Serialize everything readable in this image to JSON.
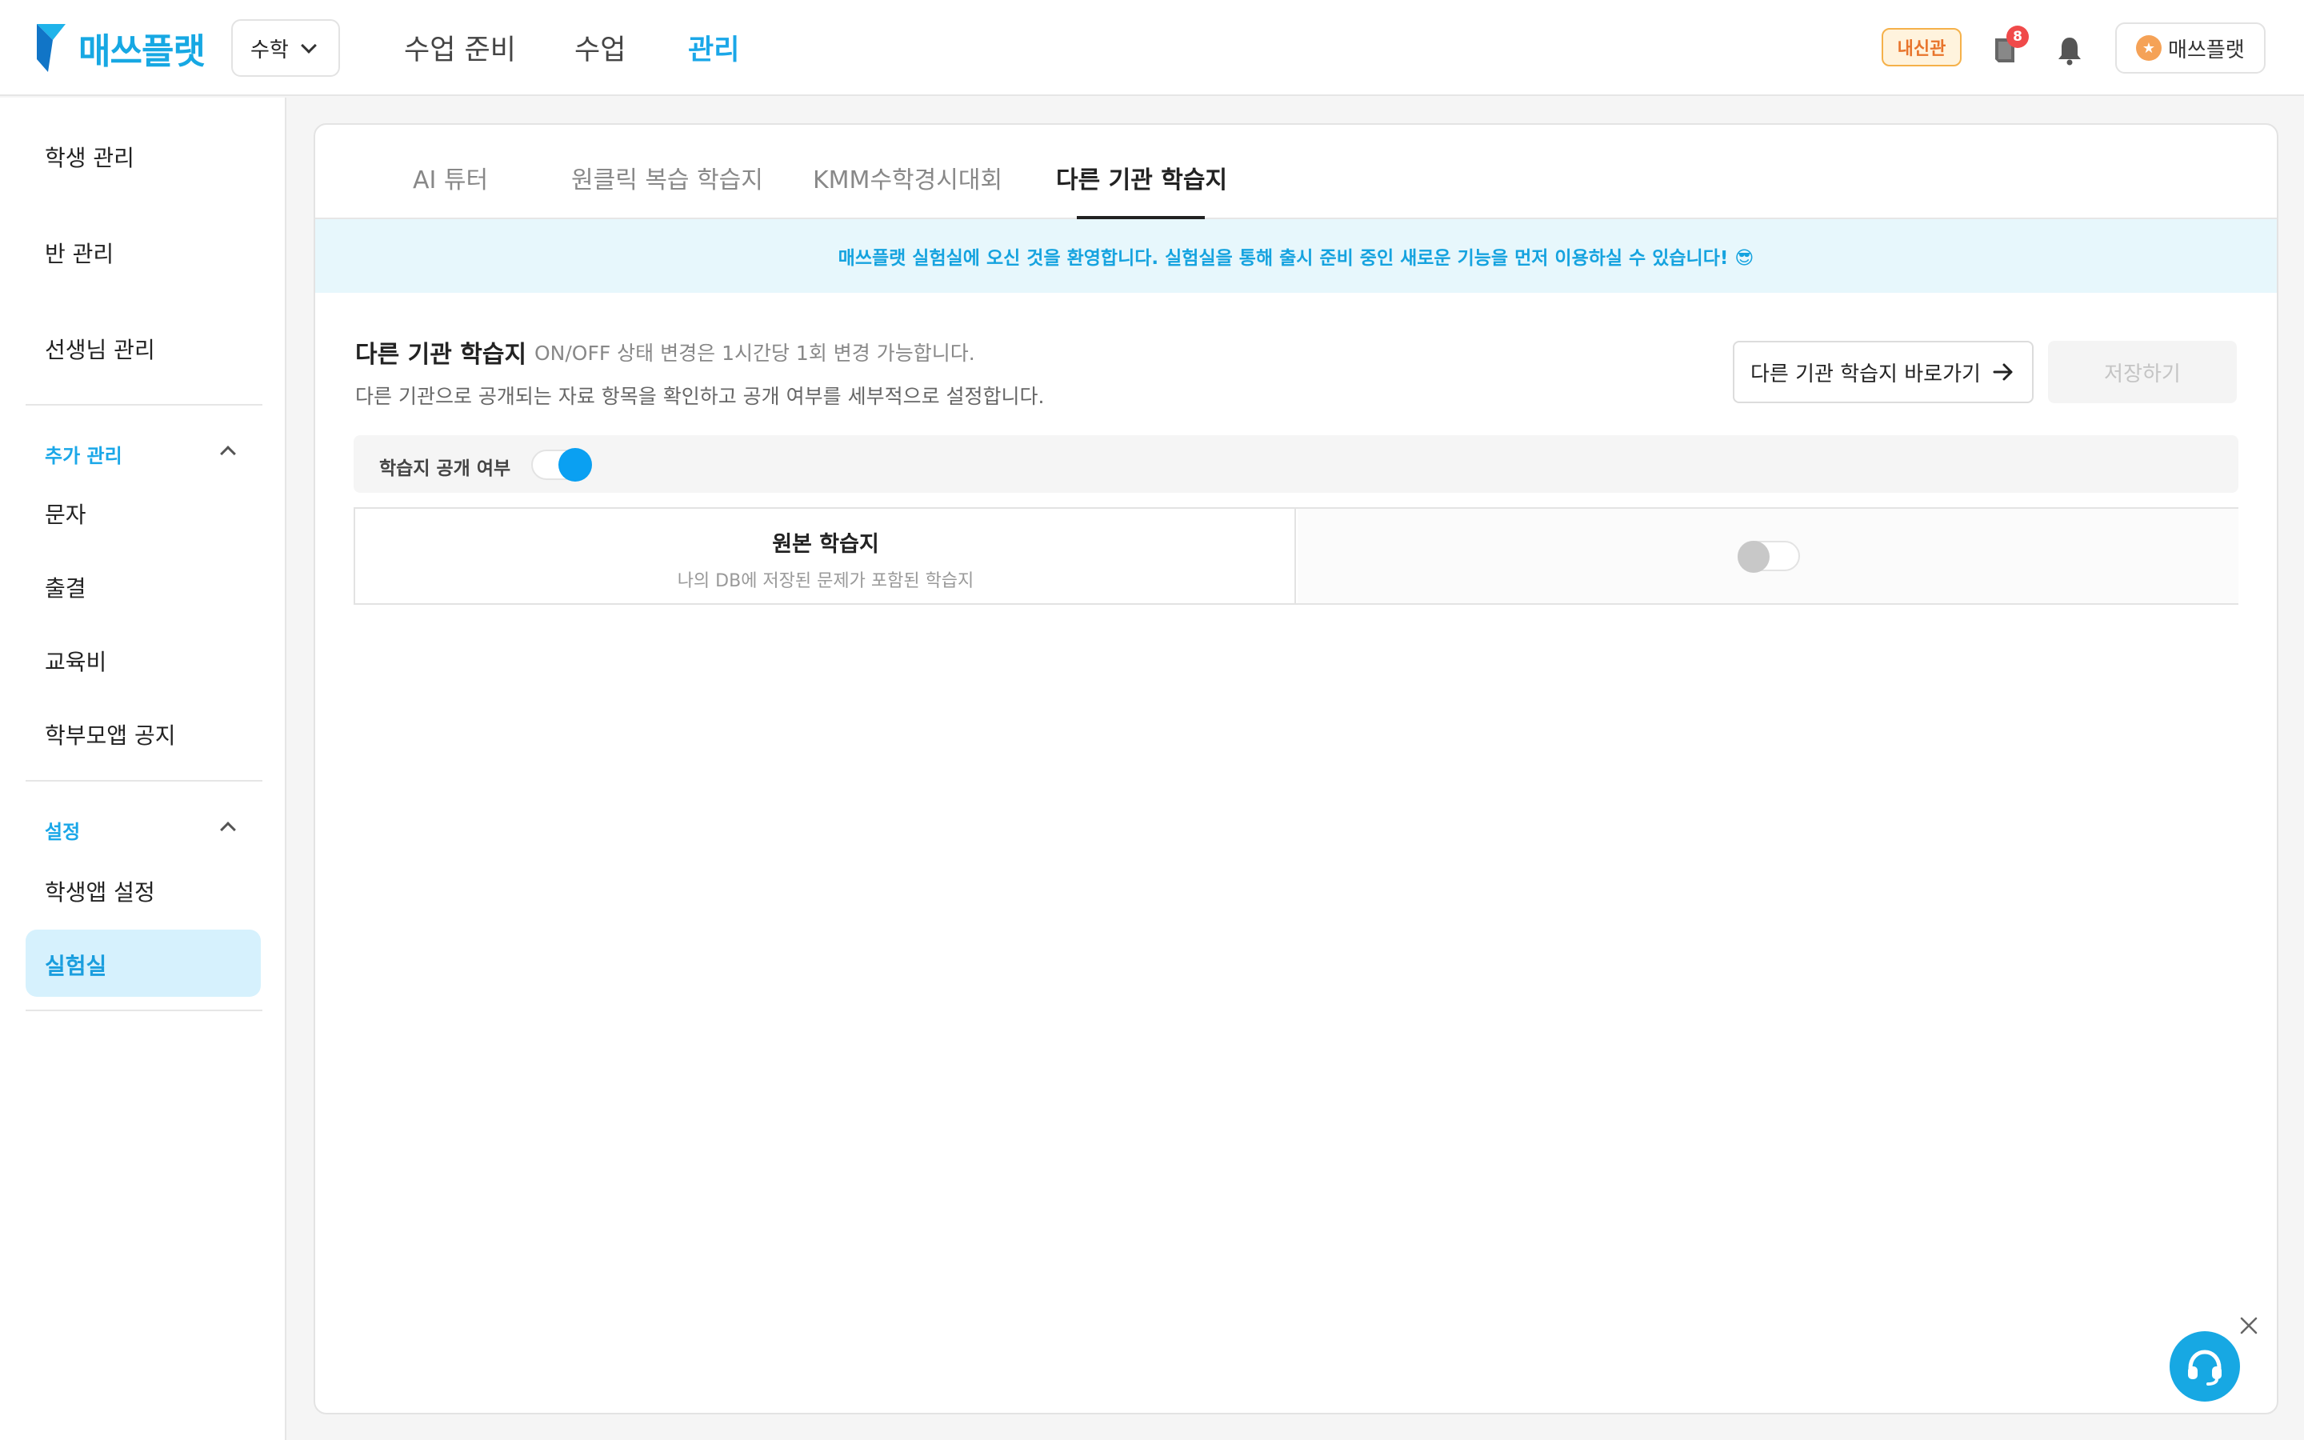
{
  "header": {
    "logo_text": "매쓰플랫",
    "subject": "수학",
    "nav": [
      "수업 준비",
      "수업",
      "관리"
    ],
    "nav_active": "관리",
    "badge_naesin": "내신관",
    "book_count": "8",
    "user_label": "매쓰플랫",
    "accent_color": "#17a8e3"
  },
  "sidebar": {
    "items_top": [
      "학생 관리",
      "반 관리",
      "선생님 관리"
    ],
    "section_extra": "추가 관리",
    "items_extra": [
      "문자",
      "출결",
      "교육비",
      "학부모앱 공지"
    ],
    "section_settings": "설정",
    "items_settings": [
      "학생앱 설정",
      "실험실"
    ],
    "active": "실험실"
  },
  "tabs": {
    "items": [
      "AI 튜터",
      "원클릭 복습 학습지",
      "KMM수학경시대회",
      "다른 기관 학습지"
    ],
    "active": "다른 기관 학습지"
  },
  "welcome_text": "매쓰플랫 실험실에 오신 것을 환영합니다. 실험실을 통해 출시 준비 중인 새로운 기능을 먼저 이용하실 수 있습니다! 😎",
  "section": {
    "title": "다른 기관 학습지",
    "note": "ON/OFF 상태 변경은 1시간당 1회 변경 가능합니다.",
    "desc": "다른 기관으로 공개되는 자료 항목을 확인하고 공개 여부를 세부적으로 설정합니다.",
    "goto_label": "다른 기관 학습지 바로가기",
    "save_label": "저장하기"
  },
  "publish_toggle": {
    "label": "학습지 공개 여부",
    "on": true
  },
  "table_row": {
    "title": "원본 학습지",
    "subtitle": "나의 DB에 저장된 문제가 포함된 학습지",
    "on": false
  },
  "icons": [
    "book-icon",
    "bell-icon",
    "arrow-right-icon",
    "close-icon",
    "headset-icon",
    "chevron-down-icon",
    "chevron-up-icon"
  ]
}
